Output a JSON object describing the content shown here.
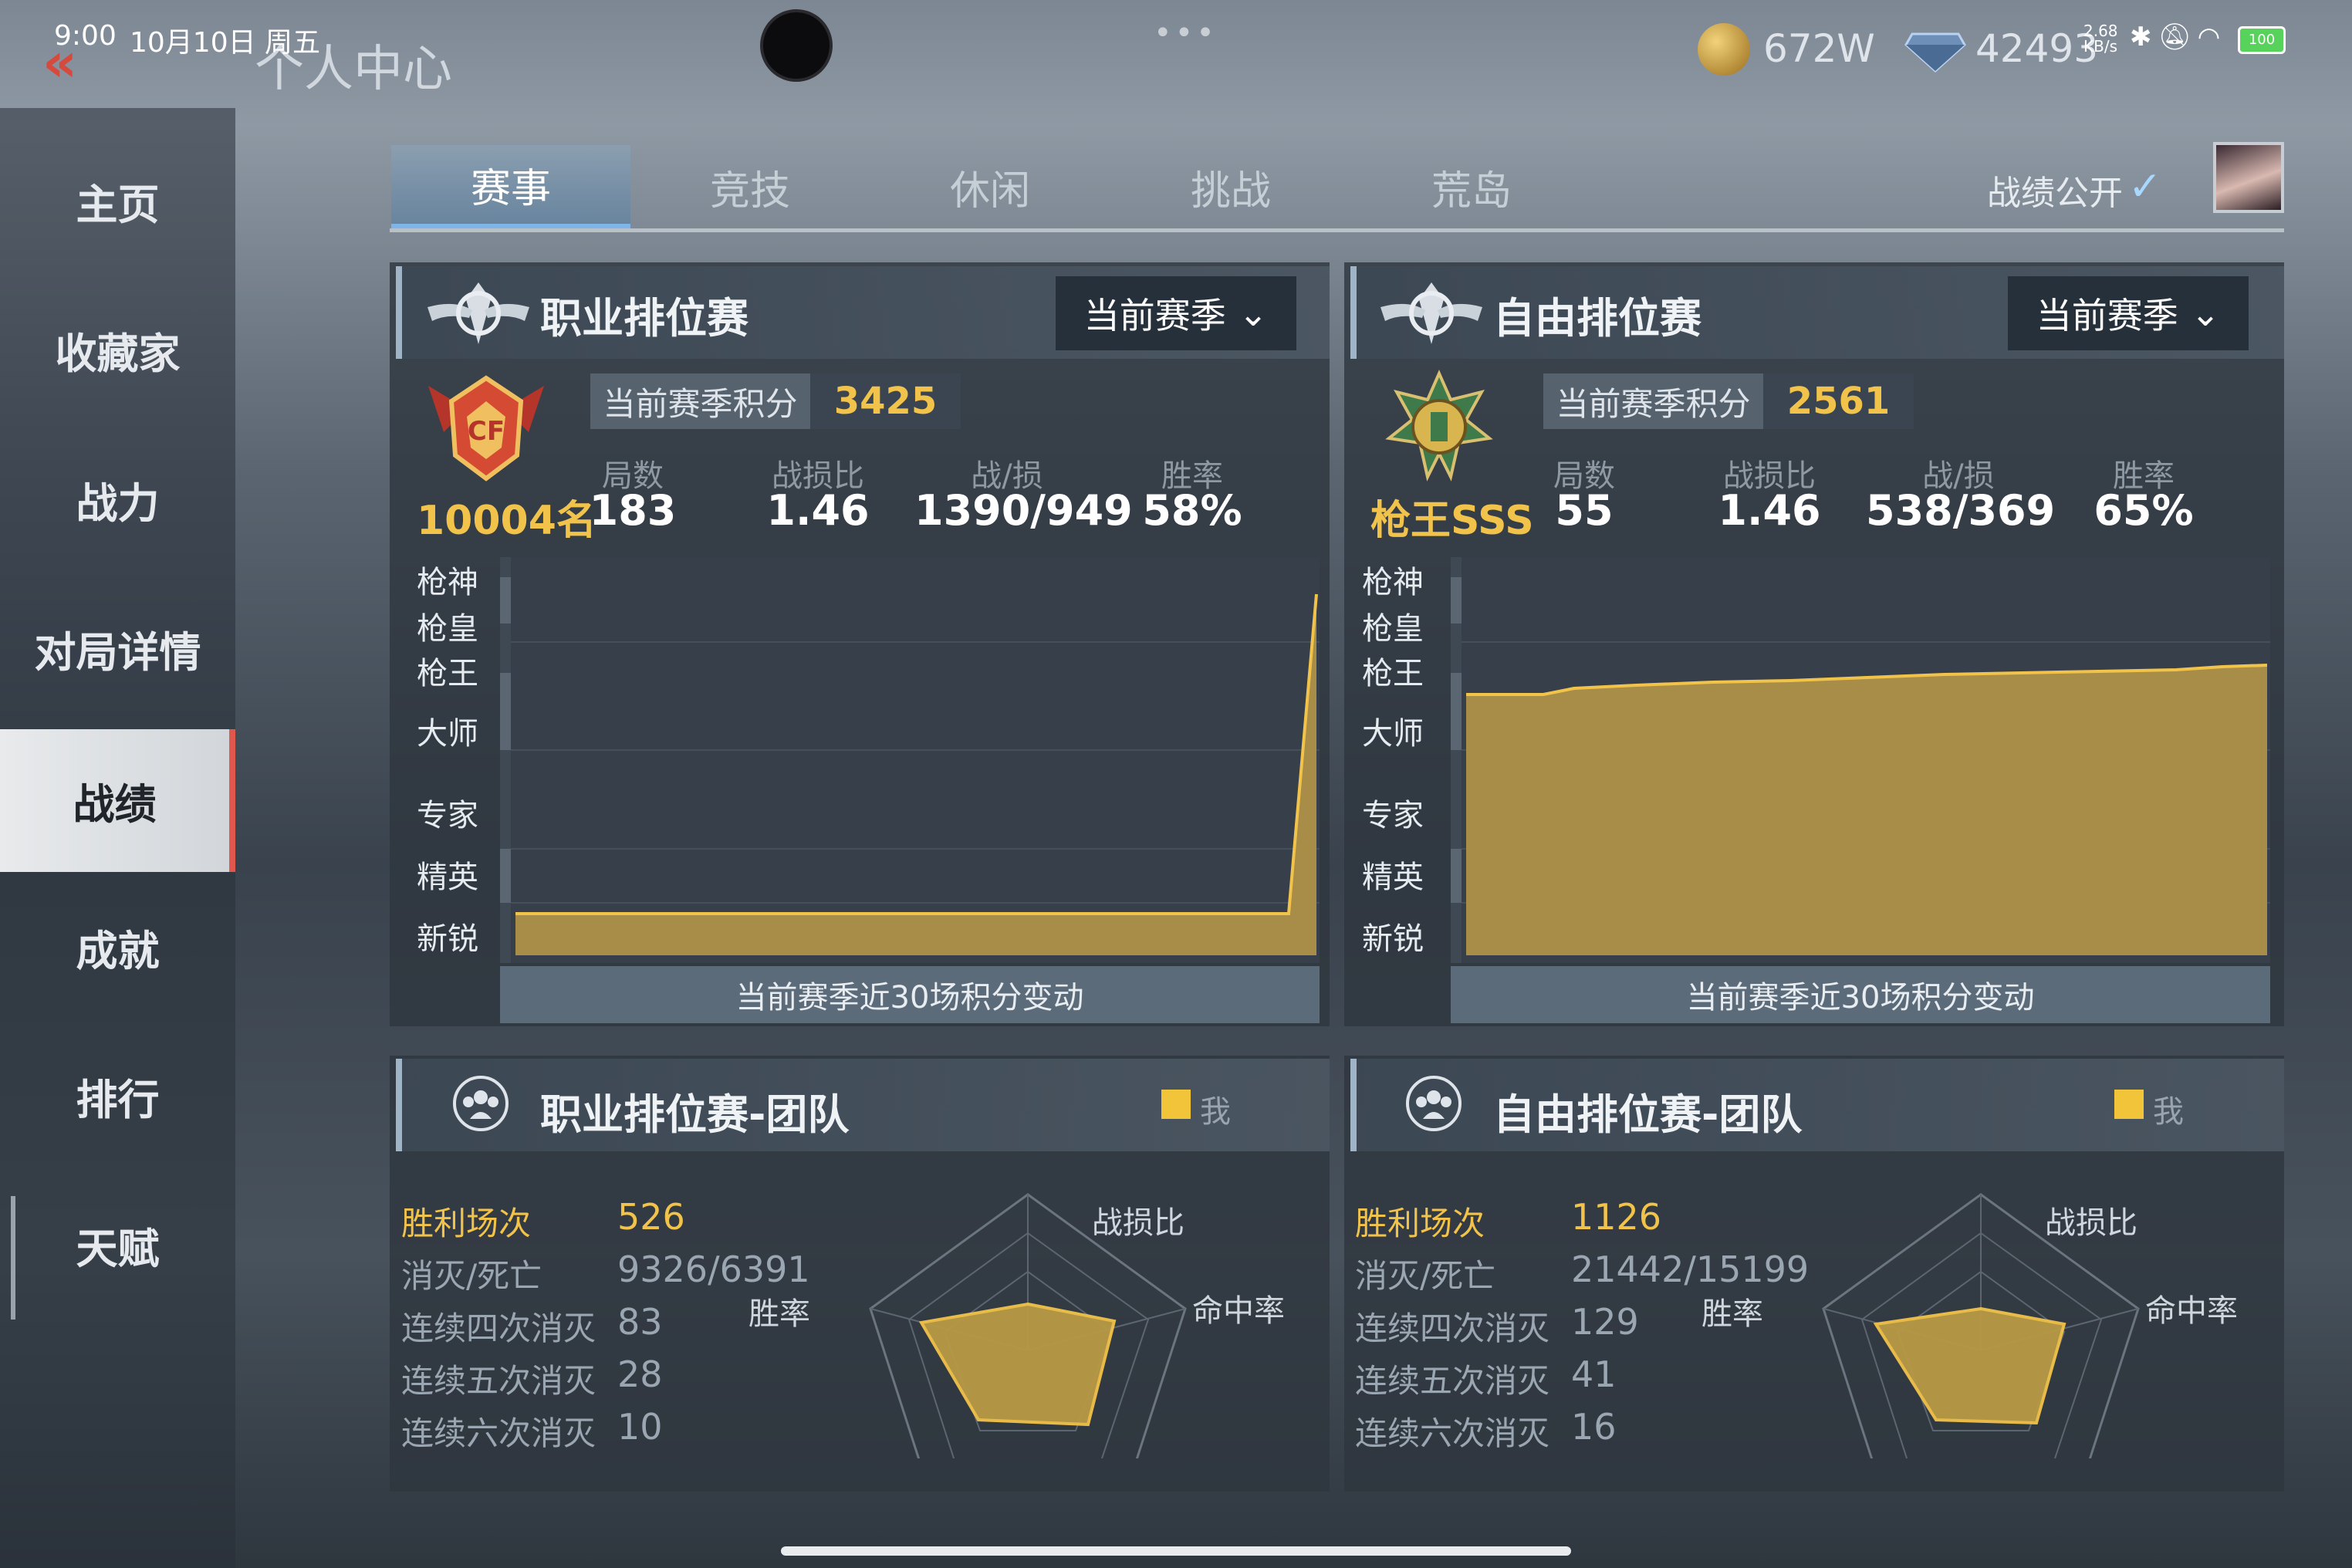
{
  "status": {
    "time": "9:00",
    "date": "10月10日 周五",
    "net_speed": "2.68",
    "net_unit": "KB/s",
    "battery": "100"
  },
  "header": {
    "title": "个人中心",
    "coins": "672W",
    "gems": "42493"
  },
  "sidebar": {
    "items": [
      {
        "label": "主页"
      },
      {
        "label": "收藏家"
      },
      {
        "label": "战力"
      },
      {
        "label": "对局详情"
      },
      {
        "label": "战绩"
      },
      {
        "label": "成就"
      },
      {
        "label": "排行"
      },
      {
        "label": "天赋"
      }
    ],
    "active_index": 4
  },
  "tabs": [
    {
      "label": "赛事"
    },
    {
      "label": "竞技"
    },
    {
      "label": "休闲"
    },
    {
      "label": "挑战"
    },
    {
      "label": "荒岛"
    }
  ],
  "public_label": "战绩公开",
  "pro_rank": {
    "title": "职业排位赛",
    "season": "当前赛季",
    "score_label": "当前赛季积分",
    "score": "3425",
    "rank": "10004名",
    "stats": [
      {
        "label": "局数",
        "value": "183"
      },
      {
        "label": "战损比",
        "value": "1.46"
      },
      {
        "label": "战/损",
        "value": "1390/949"
      },
      {
        "label": "胜率",
        "value": "58%"
      }
    ],
    "tiers": [
      "枪神",
      "枪皇",
      "枪王",
      "大师",
      "专家",
      "精英",
      "新锐"
    ],
    "caption": "当前赛季近30场积分变动"
  },
  "free_rank": {
    "title": "自由排位赛",
    "season": "当前赛季",
    "score_label": "当前赛季积分",
    "score": "2561",
    "rank": "枪王SSS",
    "stats": [
      {
        "label": "局数",
        "value": "55"
      },
      {
        "label": "战损比",
        "value": "1.46"
      },
      {
        "label": "战/损",
        "value": "538/369"
      },
      {
        "label": "胜率",
        "value": "65%"
      }
    ],
    "tiers": [
      "枪神",
      "枪皇",
      "枪王",
      "大师",
      "专家",
      "精英",
      "新锐"
    ],
    "caption": "当前赛季近30场积分变动"
  },
  "pro_team": {
    "title": "职业排位赛-团队",
    "legend": "我",
    "rows": [
      {
        "label": "胜利场次",
        "value": "526"
      },
      {
        "label": "消灭/死亡",
        "value": "9326/6391"
      },
      {
        "label": "连续四次消灭",
        "value": "83"
      },
      {
        "label": "连续五次消灭",
        "value": "28"
      },
      {
        "label": "连续六次消灭",
        "value": "10"
      }
    ],
    "radar": [
      "战损比",
      "命中率",
      "胜率"
    ]
  },
  "free_team": {
    "title": "自由排位赛-团队",
    "legend": "我",
    "rows": [
      {
        "label": "胜利场次",
        "value": "1126"
      },
      {
        "label": "消灭/死亡",
        "value": "21442/15199"
      },
      {
        "label": "连续四次消灭",
        "value": "129"
      },
      {
        "label": "连续五次消灭",
        "value": "41"
      },
      {
        "label": "连续六次消灭",
        "value": "16"
      }
    ],
    "radar": [
      "战损比",
      "命中率",
      "胜率"
    ]
  },
  "colors": {
    "accent_gold": "#f2c34a",
    "active_red": "#e2574c",
    "chart_fill": "#a78d48"
  }
}
